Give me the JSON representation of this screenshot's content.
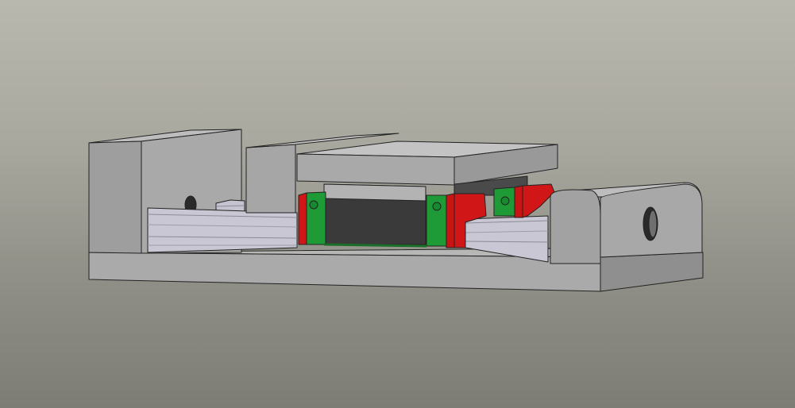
{
  "viewport": {
    "background_top": "#b9b8ae",
    "background_bottom": "#7d7c75"
  },
  "model": {
    "components": [
      "base-plate",
      "left-end-block",
      "right-end-block",
      "rear-linear-rail",
      "front-linear-rail",
      "carriage-plate",
      "center-spacer-block",
      "bearing-block-front",
      "bearing-block-rear"
    ],
    "colors": {
      "grey_part": "#a9a9a9",
      "rail": "#c7c6d2",
      "bearing_green": "#1e9a37",
      "bearing_red": "#d01616",
      "dark_body": "#3a3a3a",
      "edge": "#222222"
    }
  }
}
